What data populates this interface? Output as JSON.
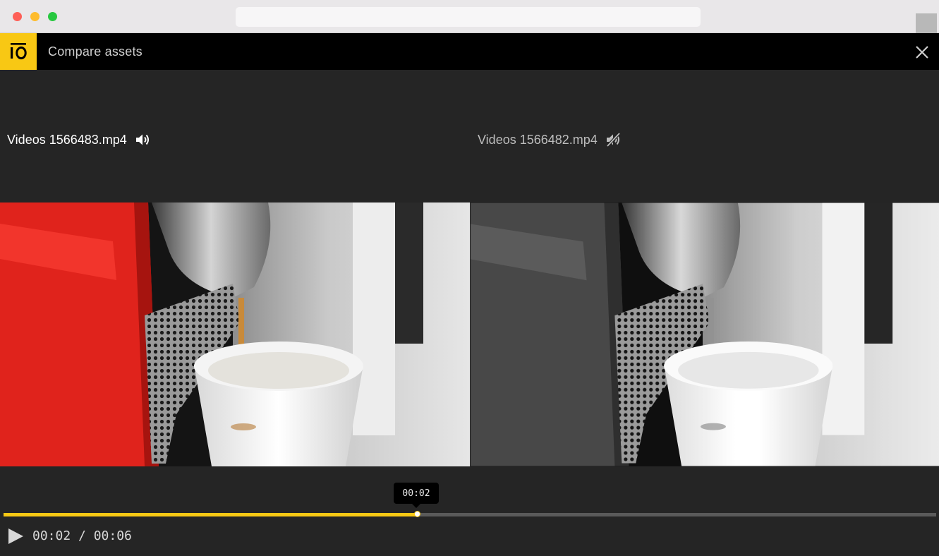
{
  "app": {
    "title": "Compare assets",
    "accent_color": "#f8c814",
    "logo_icon": "io-logo-icon",
    "close_icon": "close-icon"
  },
  "videos": [
    {
      "filename": "Videos 1566483.mp4",
      "audio_icon": "volume-on-icon",
      "muted": false,
      "color_mode": "color"
    },
    {
      "filename": "Videos 1566482.mp4",
      "audio_icon": "volume-muted-icon",
      "muted": true,
      "color_mode": "grayscale"
    }
  ],
  "player": {
    "tooltip_time": "00:02",
    "current_time": "00:02",
    "separator": " / ",
    "duration": "00:06",
    "progress": 0.443,
    "play_icon": "play-icon"
  }
}
